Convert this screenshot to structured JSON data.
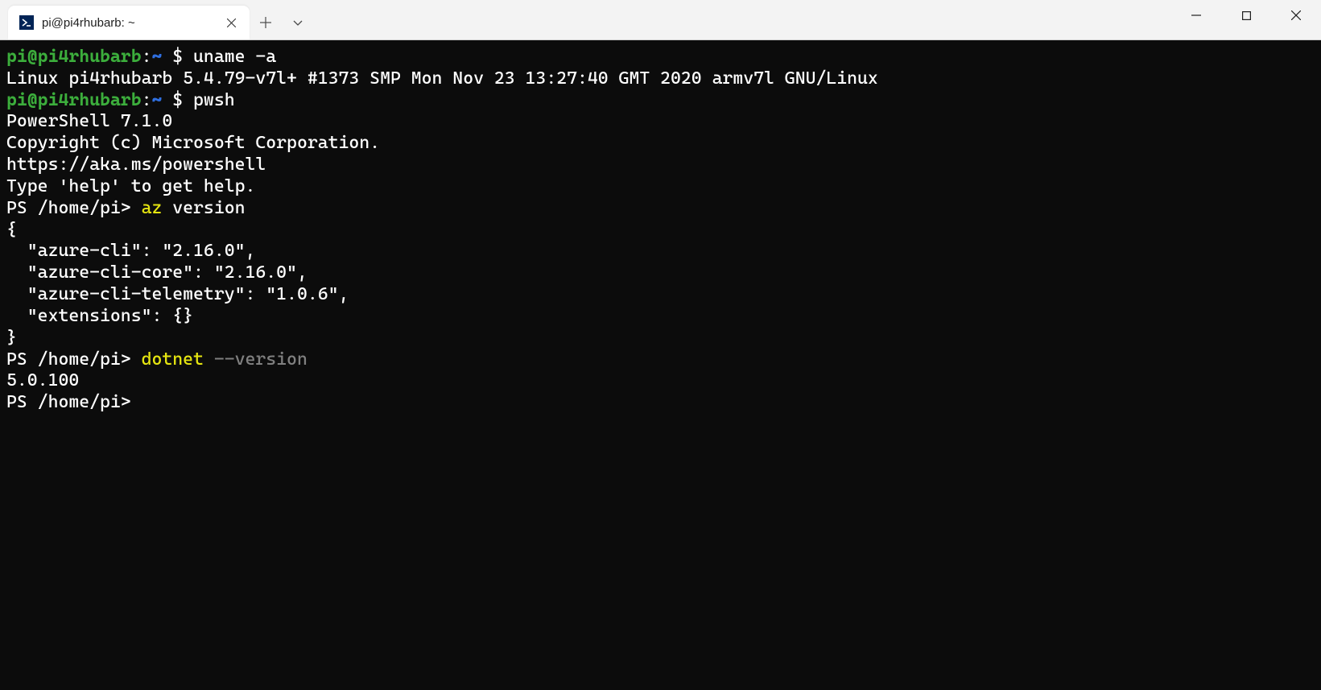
{
  "titlebar": {
    "tab": {
      "title": "pi@pi4rhubarb: ~"
    }
  },
  "prompts": {
    "bash_user_host": "pi@pi4rhubarb",
    "bash_sep": ":",
    "bash_path": "~",
    "bash_dollar": " $ ",
    "ps_prefix": "PS /home/pi> "
  },
  "cmd1": "uname -a",
  "out1": "Linux pi4rhubarb 5.4.79-v7l+ #1373 SMP Mon Nov 23 13:27:40 GMT 2020 armv7l GNU/Linux",
  "cmd2": "pwsh",
  "out2_1": "PowerShell 7.1.0",
  "out2_2": "Copyright (c) Microsoft Corporation.",
  "out2_3": "",
  "out2_4": "https://aka.ms/powershell",
  "out2_5": "Type 'help' to get help.",
  "out2_6": "",
  "cmd3_yellow": "az",
  "cmd3_rest": " version",
  "out3_1": "{",
  "out3_2": "  \"azure-cli\": \"2.16.0\",",
  "out3_3": "  \"azure-cli-core\": \"2.16.0\",",
  "out3_4": "  \"azure-cli-telemetry\": \"1.0.6\",",
  "out3_5": "  \"extensions\": {}",
  "out3_6": "}",
  "cmd4_yellow": "dotnet",
  "cmd4_gray": " --version",
  "out4": "5.0.100"
}
